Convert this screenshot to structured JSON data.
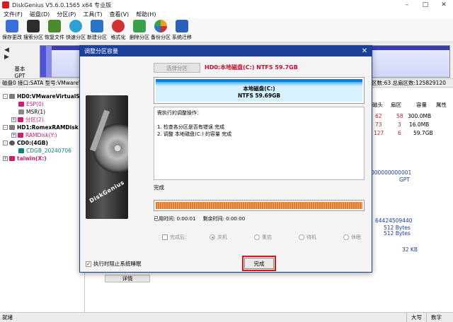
{
  "window": {
    "title": "DiskGenius V5.6.0.1565 x64 专业版",
    "controls": [
      "–",
      "□",
      "✕"
    ]
  },
  "menu": [
    "文件(F)",
    "磁盘(D)",
    "分区(P)",
    "工具(T)",
    "查看(V)",
    "帮助(H)"
  ],
  "toolbar": [
    {
      "label": "保存更改",
      "icon": "save-icon",
      "color": "#3a6fd8"
    },
    {
      "label": "搜索分区",
      "icon": "search-partition-icon",
      "color": "#2c2c2c"
    },
    {
      "label": "恢复文件",
      "icon": "recover-file-icon",
      "color": "#4a8a2a"
    },
    {
      "label": "快速分区",
      "icon": "quick-partition-icon",
      "color": "#2da0d8"
    },
    {
      "label": "新建分区",
      "icon": "new-partition-icon",
      "color": "#2a74c8"
    },
    {
      "label": "格式化",
      "icon": "format-icon",
      "color": "#d03030"
    },
    {
      "label": "删除分区",
      "icon": "delete-partition-icon",
      "color": "#3aa04a"
    },
    {
      "label": "备份分区",
      "icon": "backup-partition-icon",
      "color": "#e8a020"
    },
    {
      "label": "系统迁移",
      "icon": "system-migration-icon",
      "color": "#2a60b8"
    }
  ],
  "diskmap": {
    "arrows": "◀ ▶",
    "type": "基本",
    "scheme": "GPT"
  },
  "inforow": {
    "left": "磁盘0 接口:SATA  型号:VMwareV",
    "right": "区数:63  总扇区数:125829120"
  },
  "tree": [
    {
      "label": "HD0:VMwareVirtualS",
      "style": "bold",
      "toggle": "-"
    },
    {
      "label": "ESP(0)",
      "style": "pink",
      "toggle": ""
    },
    {
      "label": "MSR(1)",
      "style": "plain",
      "toggle": ""
    },
    {
      "label": "分区(2)",
      "style": "pink",
      "toggle": "+"
    },
    {
      "label": "HD1:RomexRAMDisk",
      "style": "bold",
      "toggle": "-"
    },
    {
      "label": "RAMDisk(Y:)",
      "style": "pink",
      "toggle": "+"
    },
    {
      "label": "CD0:(4GB)",
      "style": "bold",
      "toggle": "-"
    },
    {
      "label": "CDGB_20240706",
      "style": "teal",
      "toggle": ""
    },
    {
      "label": "taiwin(X:)",
      "style": "bold-pink",
      "toggle": "+"
    }
  ],
  "rightpane": {
    "col_headers": [
      "磁头",
      "扇区",
      "容量",
      "属性"
    ],
    "rows": [
      [
        "62",
        "58",
        "300.0MB",
        ""
      ],
      [
        "73",
        "3",
        "16.0MB",
        ""
      ],
      [
        "127",
        "6",
        "59.7GB",
        ""
      ]
    ],
    "values": [
      "000000000001",
      "GPT",
      "64424509440",
      "512 Bytes",
      "512 Bytes",
      "32 KB"
    ],
    "details_tab": "详情"
  },
  "status": {
    "left": "就绪",
    "caps": "大写",
    "num": "数字"
  },
  "dialog": {
    "title": "调整分区容量",
    "close": "✕",
    "brand": "DiskGenius",
    "select_partition_button": "选择分区",
    "partition_info": "HD0:本地磁盘(C:) NTFS 59.7GB",
    "partition_name": "本地磁盘(C:)",
    "partition_size": "NTFS 59.69GB",
    "log_header": "需执行的调整操作：",
    "log_lines": [
      "1. 检查各分区是否有错误    完成",
      "2. 调整 本地磁盘(C:) 的容量    完成"
    ],
    "status_text": "完成",
    "progress_fraction": 1.0,
    "used_time": "已用时间:  0:00:01",
    "remaining_time": "剩余时间:  0:00:00",
    "after_done_label": "完成后：",
    "after_done_options": [
      "关机",
      "重启",
      "待机",
      "休眠"
    ],
    "prevent_sleep_label": "执行时阻止系统睡眠",
    "finish_button": "完成"
  }
}
